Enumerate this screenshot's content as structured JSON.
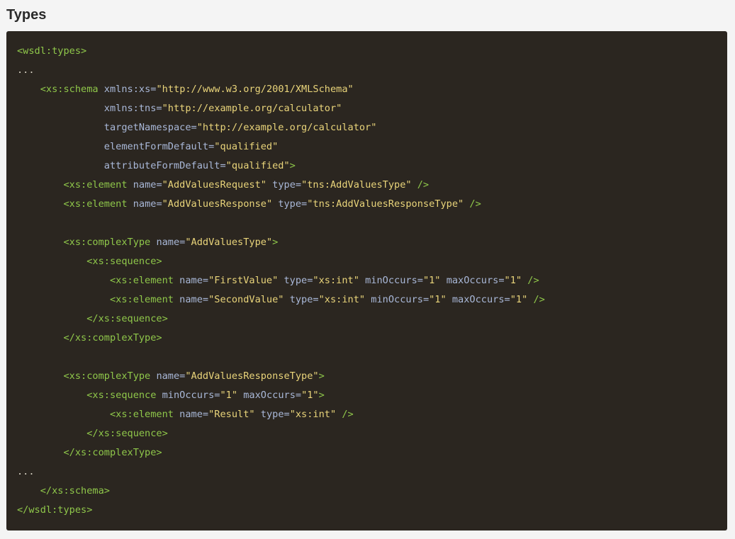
{
  "section": {
    "title": "Types"
  },
  "colors": {
    "background": "#f4f4f4",
    "code_background": "#2b2620",
    "tag": "#8fc74a",
    "attribute": "#a9b8d8",
    "string": "#e9d47a",
    "text": "#d7d2c4"
  },
  "code": {
    "language": "xml",
    "lines": [
      [
        {
          "t": "tag",
          "v": "<wsdl:types>"
        }
      ],
      [
        {
          "t": "plain",
          "v": "..."
        }
      ],
      [
        {
          "t": "plain",
          "v": "    "
        },
        {
          "t": "tag",
          "v": "<xs:schema"
        },
        {
          "t": "plain",
          "v": " "
        },
        {
          "t": "attr",
          "v": "xmlns:xs="
        },
        {
          "t": "str",
          "v": "\"http://www.w3.org/2001/XMLSchema\""
        }
      ],
      [
        {
          "t": "plain",
          "v": "               "
        },
        {
          "t": "attr",
          "v": "xmlns:tns="
        },
        {
          "t": "str",
          "v": "\"http://example.org/calculator\""
        }
      ],
      [
        {
          "t": "plain",
          "v": "               "
        },
        {
          "t": "attr",
          "v": "targetNamespace="
        },
        {
          "t": "str",
          "v": "\"http://example.org/calculator\""
        }
      ],
      [
        {
          "t": "plain",
          "v": "               "
        },
        {
          "t": "attr",
          "v": "elementFormDefault="
        },
        {
          "t": "str",
          "v": "\"qualified\""
        }
      ],
      [
        {
          "t": "plain",
          "v": "               "
        },
        {
          "t": "attr",
          "v": "attributeFormDefault="
        },
        {
          "t": "str",
          "v": "\"qualified\""
        },
        {
          "t": "tag",
          "v": ">"
        }
      ],
      [
        {
          "t": "plain",
          "v": "        "
        },
        {
          "t": "tag",
          "v": "<xs:element"
        },
        {
          "t": "plain",
          "v": " "
        },
        {
          "t": "attr",
          "v": "name="
        },
        {
          "t": "str",
          "v": "\"AddValuesRequest\""
        },
        {
          "t": "plain",
          "v": " "
        },
        {
          "t": "attr",
          "v": "type="
        },
        {
          "t": "str",
          "v": "\"tns:AddValuesType\""
        },
        {
          "t": "plain",
          "v": " "
        },
        {
          "t": "tag",
          "v": "/>"
        }
      ],
      [
        {
          "t": "plain",
          "v": "        "
        },
        {
          "t": "tag",
          "v": "<xs:element"
        },
        {
          "t": "plain",
          "v": " "
        },
        {
          "t": "attr",
          "v": "name="
        },
        {
          "t": "str",
          "v": "\"AddValuesResponse\""
        },
        {
          "t": "plain",
          "v": " "
        },
        {
          "t": "attr",
          "v": "type="
        },
        {
          "t": "str",
          "v": "\"tns:AddValuesResponseType\""
        },
        {
          "t": "plain",
          "v": " "
        },
        {
          "t": "tag",
          "v": "/>"
        }
      ],
      [],
      [
        {
          "t": "plain",
          "v": "        "
        },
        {
          "t": "tag",
          "v": "<xs:complexType"
        },
        {
          "t": "plain",
          "v": " "
        },
        {
          "t": "attr",
          "v": "name="
        },
        {
          "t": "str",
          "v": "\"AddValuesType\""
        },
        {
          "t": "tag",
          "v": ">"
        }
      ],
      [
        {
          "t": "plain",
          "v": "            "
        },
        {
          "t": "tag",
          "v": "<xs:sequence>"
        }
      ],
      [
        {
          "t": "plain",
          "v": "                "
        },
        {
          "t": "tag",
          "v": "<xs:element"
        },
        {
          "t": "plain",
          "v": " "
        },
        {
          "t": "attr",
          "v": "name="
        },
        {
          "t": "str",
          "v": "\"FirstValue\""
        },
        {
          "t": "plain",
          "v": " "
        },
        {
          "t": "attr",
          "v": "type="
        },
        {
          "t": "str",
          "v": "\"xs:int\""
        },
        {
          "t": "plain",
          "v": " "
        },
        {
          "t": "attr",
          "v": "minOccurs="
        },
        {
          "t": "str",
          "v": "\"1\""
        },
        {
          "t": "plain",
          "v": " "
        },
        {
          "t": "attr",
          "v": "maxOccurs="
        },
        {
          "t": "str",
          "v": "\"1\""
        },
        {
          "t": "plain",
          "v": " "
        },
        {
          "t": "tag",
          "v": "/>"
        }
      ],
      [
        {
          "t": "plain",
          "v": "                "
        },
        {
          "t": "tag",
          "v": "<xs:element"
        },
        {
          "t": "plain",
          "v": " "
        },
        {
          "t": "attr",
          "v": "name="
        },
        {
          "t": "str",
          "v": "\"SecondValue\""
        },
        {
          "t": "plain",
          "v": " "
        },
        {
          "t": "attr",
          "v": "type="
        },
        {
          "t": "str",
          "v": "\"xs:int\""
        },
        {
          "t": "plain",
          "v": " "
        },
        {
          "t": "attr",
          "v": "minOccurs="
        },
        {
          "t": "str",
          "v": "\"1\""
        },
        {
          "t": "plain",
          "v": " "
        },
        {
          "t": "attr",
          "v": "maxOccurs="
        },
        {
          "t": "str",
          "v": "\"1\""
        },
        {
          "t": "plain",
          "v": " "
        },
        {
          "t": "tag",
          "v": "/>"
        }
      ],
      [
        {
          "t": "plain",
          "v": "            "
        },
        {
          "t": "tag",
          "v": "</xs:sequence>"
        }
      ],
      [
        {
          "t": "plain",
          "v": "        "
        },
        {
          "t": "tag",
          "v": "</xs:complexType>"
        }
      ],
      [],
      [
        {
          "t": "plain",
          "v": "        "
        },
        {
          "t": "tag",
          "v": "<xs:complexType"
        },
        {
          "t": "plain",
          "v": " "
        },
        {
          "t": "attr",
          "v": "name="
        },
        {
          "t": "str",
          "v": "\"AddValuesResponseType\""
        },
        {
          "t": "tag",
          "v": ">"
        }
      ],
      [
        {
          "t": "plain",
          "v": "            "
        },
        {
          "t": "tag",
          "v": "<xs:sequence"
        },
        {
          "t": "plain",
          "v": " "
        },
        {
          "t": "attr",
          "v": "minOccurs="
        },
        {
          "t": "str",
          "v": "\"1\""
        },
        {
          "t": "plain",
          "v": " "
        },
        {
          "t": "attr",
          "v": "maxOccurs="
        },
        {
          "t": "str",
          "v": "\"1\""
        },
        {
          "t": "tag",
          "v": ">"
        }
      ],
      [
        {
          "t": "plain",
          "v": "                "
        },
        {
          "t": "tag",
          "v": "<xs:element"
        },
        {
          "t": "plain",
          "v": " "
        },
        {
          "t": "attr",
          "v": "name="
        },
        {
          "t": "str",
          "v": "\"Result\""
        },
        {
          "t": "plain",
          "v": " "
        },
        {
          "t": "attr",
          "v": "type="
        },
        {
          "t": "str",
          "v": "\"xs:int\""
        },
        {
          "t": "plain",
          "v": " "
        },
        {
          "t": "tag",
          "v": "/>"
        }
      ],
      [
        {
          "t": "plain",
          "v": "            "
        },
        {
          "t": "tag",
          "v": "</xs:sequence>"
        }
      ],
      [
        {
          "t": "plain",
          "v": "        "
        },
        {
          "t": "tag",
          "v": "</xs:complexType>"
        }
      ],
      [
        {
          "t": "plain",
          "v": "..."
        }
      ],
      [
        {
          "t": "plain",
          "v": "    "
        },
        {
          "t": "tag",
          "v": "</xs:schema>"
        }
      ],
      [
        {
          "t": "tag",
          "v": "</wsdl:types>"
        }
      ]
    ]
  }
}
